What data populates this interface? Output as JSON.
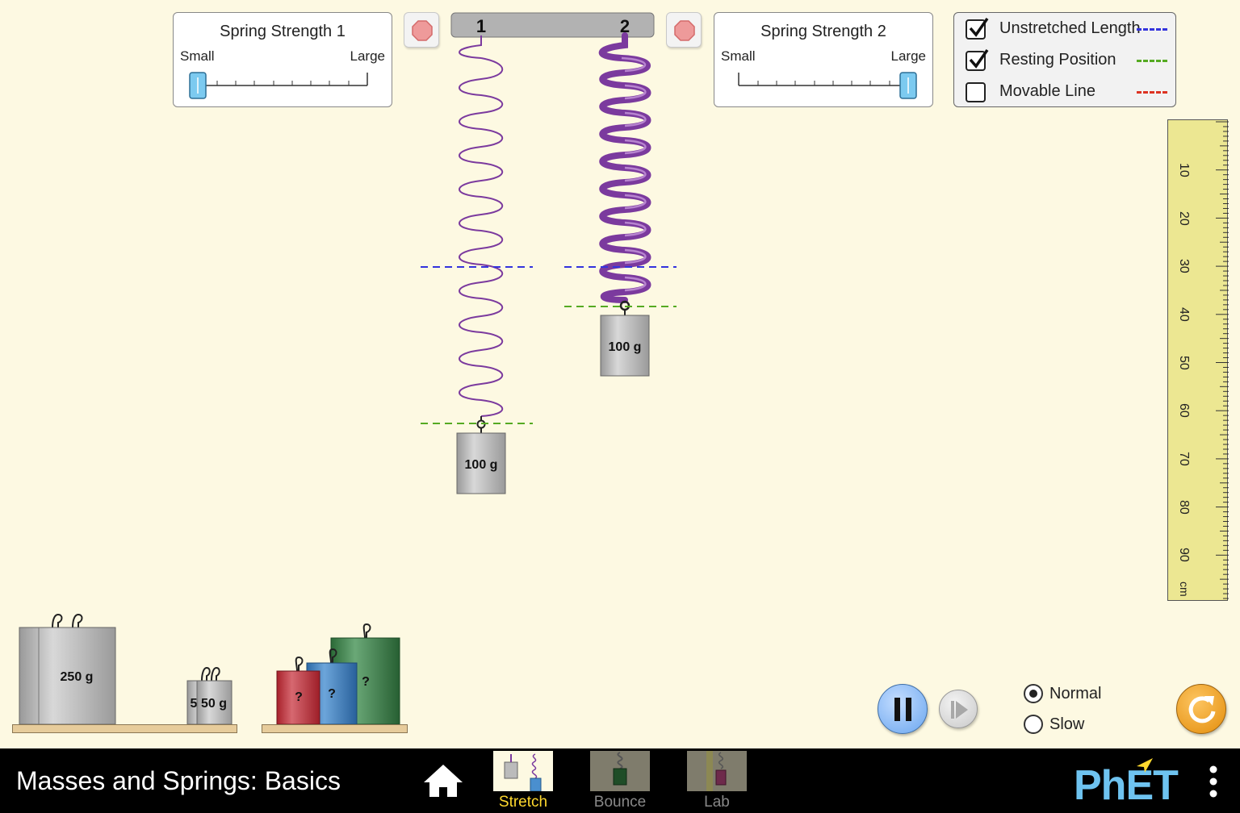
{
  "spring_panel_1": {
    "title": "Spring Strength 1",
    "small_label": "Small",
    "large_label": "Large",
    "strength": 0.0
  },
  "spring_panel_2": {
    "title": "Spring Strength 2",
    "small_label": "Small",
    "large_label": "Large",
    "strength": 1.0
  },
  "ceiling": {
    "spring1_label": "1",
    "spring2_label": "2"
  },
  "visibility_panel": {
    "items": [
      {
        "label": "Unstretched Length",
        "checked": true,
        "color": "#3333dd"
      },
      {
        "label": "Resting Position",
        "checked": true,
        "color": "#55aa22"
      },
      {
        "label": "Movable Line",
        "checked": false,
        "color": "#dd3322"
      }
    ]
  },
  "ruler": {
    "labels": [
      "10",
      "20",
      "30",
      "40",
      "50",
      "60",
      "70",
      "80",
      "90"
    ],
    "unit": "cm"
  },
  "hanging_masses": {
    "spring1_mass": "100 g",
    "spring2_mass": "100 g"
  },
  "mass_shelf": {
    "large_mass": "250 g",
    "small_mass_partial": "5",
    "small_mass": "50 g"
  },
  "mystery_shelf": {
    "red": "?",
    "blue": "?",
    "green": "?"
  },
  "speed": {
    "options": [
      "Normal",
      "Slow"
    ],
    "selected": "Normal"
  },
  "bottom_bar": {
    "app_title": "Masses and Springs: Basics",
    "screens": [
      {
        "label": "Stretch",
        "active": true
      },
      {
        "label": "Bounce",
        "active": false
      },
      {
        "label": "Lab",
        "active": false
      }
    ],
    "brand": "PhET"
  },
  "colors": {
    "background": "#fdf9e2",
    "spring": "#7b3a9e",
    "active_tab": "#ffd92e",
    "inactive_tab": "#888888"
  }
}
